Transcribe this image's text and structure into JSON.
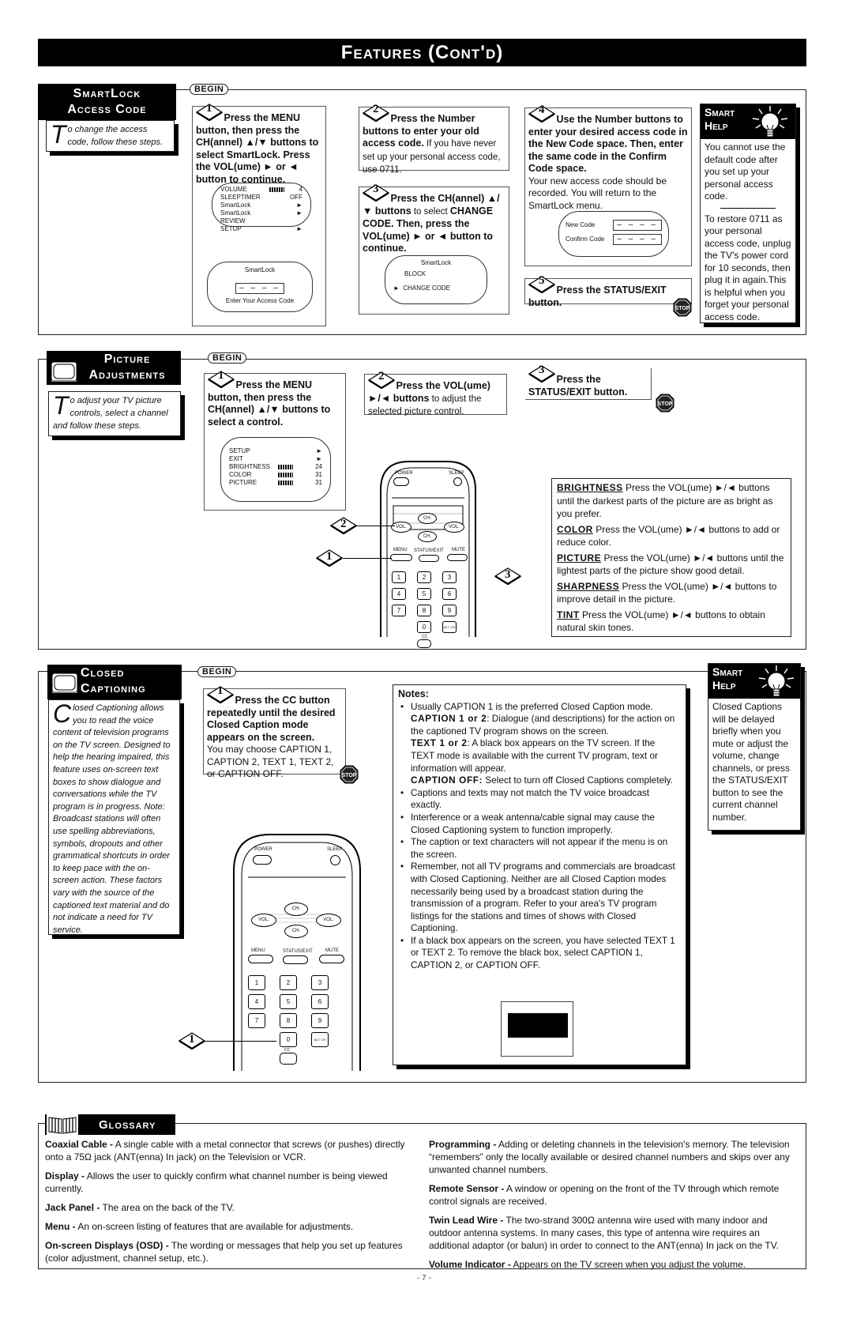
{
  "page": {
    "title": "Features (Cont'd)",
    "page_number": "- 7 -",
    "begin_label": "BEGIN"
  },
  "smartlock": {
    "title_line1": "SmartLock",
    "title_line2": "Access Code",
    "intro_dropcap": "T",
    "intro": "o change the access code, follow these steps.",
    "steps": [
      {
        "num": "1",
        "bold": "Press the MENU button, then press the CH(annel) ▲/▼ buttons to select SmartLock. Press the VOL(ume) ► or ◄ button to continue.",
        "plain": ""
      },
      {
        "num": "2",
        "bold": "Press the Number buttons to enter your old access code.",
        "plain": " If you have never set up your personal access code, use 0711."
      },
      {
        "num": "3",
        "bold": "Press the CH(annel) ▲/▼ buttons",
        "plain": " to select ",
        "bold2": "CHANGE CODE. Then, press the VOL(ume) ► or ◄ button to continue."
      },
      {
        "num": "4",
        "bold": "Use the Number buttons to enter your desired access code in the New Code space. Then, enter the same code in the Confirm Code space.",
        "plain": "Your new access code should be recorded. You will return to the SmartLock menu."
      },
      {
        "num": "5",
        "bold": "Press the STATUS/EXIT button.",
        "plain": ""
      }
    ],
    "osd_menu": [
      {
        "label": "VOLUME",
        "bar": true,
        "value": "4"
      },
      {
        "label": "SLEEPTIMER",
        "bar": false,
        "value": "OFF"
      },
      {
        "label": "SmartLock",
        "bar": false,
        "value": "►"
      },
      {
        "label": "SmartLock REVIEW",
        "bar": false,
        "value": "►"
      },
      {
        "label": "SETUP",
        "bar": false,
        "value": "►"
      }
    ],
    "osd_entry": {
      "title": "SmartLock",
      "code": "– – – –",
      "caption": "Enter Your Access Code"
    },
    "osd_smartlock": {
      "title": "SmartLock",
      "items": [
        "BLOCK",
        "CHANGE CODE"
      ],
      "selected_marker": "►"
    },
    "osd_newcode": {
      "new_label": "New Code",
      "confirm_label": "Confirm Code",
      "code": "– – – –"
    },
    "smart_help": {
      "title_line1": "Smart",
      "title_line2": "Help",
      "text1": "You cannot use the default code after you set up your personal access code.",
      "text2": "To restore 0711 as your personal access code, unplug the TV's power cord for 10 seconds, then plug it in again.This is helpful when you forget your personal access code."
    },
    "stop_label": "STOP"
  },
  "picture": {
    "title_line1": "Picture",
    "title_line2": "Adjustments",
    "intro_dropcap": "T",
    "intro": "o adjust your TV picture controls, select a channel and follow these steps.",
    "steps": [
      {
        "num": "1",
        "bold": "Press the MENU button, then press the CH(annel) ▲/▼ buttons to select a control.",
        "plain": ""
      },
      {
        "num": "2",
        "bold": "Press the VOL(ume) ►/◄ buttons",
        "plain": " to adjust the selected picture control."
      },
      {
        "num": "3",
        "bold": "Press the STATUS/EXIT button.",
        "plain": ""
      }
    ],
    "osd_menu": [
      {
        "label": "SETUP",
        "bar": false,
        "value": "►"
      },
      {
        "label": "EXIT",
        "bar": false,
        "value": "►"
      },
      {
        "label": "BRIGHTNESS",
        "bar": true,
        "value": "24"
      },
      {
        "label": "COLOR",
        "bar": true,
        "value": "31"
      },
      {
        "label": "PICTURE",
        "bar": true,
        "value": "31"
      }
    ],
    "controls": [
      {
        "term": "BRIGHTNESS",
        "desc": "Press the VOL(ume) ►/◄ buttons until the darkest parts of the picture are as bright as you prefer."
      },
      {
        "term": "COLOR",
        "desc": "Press the VOL(ume) ►/◄ buttons to add or reduce color."
      },
      {
        "term": "PICTURE",
        "desc": "Press the VOL(ume) ►/◄ buttons until the lightest parts of the picture show good detail."
      },
      {
        "term": "SHARPNESS",
        "desc": "Press the VOL(ume) ►/◄ buttons to improve detail in the picture."
      },
      {
        "term": "TINT",
        "desc": "Press the VOL(ume) ►/◄ buttons to obtain natural skin tones."
      }
    ]
  },
  "remote": {
    "power": "POWER",
    "sleep": "SLEEP",
    "ch": "CH.",
    "vol": "VOL.",
    "menu": "MENU",
    "status_exit": "STATUS/EXIT",
    "mute": "MUTE",
    "keys": [
      "1",
      "2",
      "3",
      "4",
      "5",
      "6",
      "7",
      "8",
      "9",
      "0"
    ],
    "alt_ch": "ALT. CH",
    "cc": "CC"
  },
  "closed_captioning": {
    "title_line1": "Closed",
    "title_line2": "Captioning",
    "intro_dropcap": "C",
    "intro": "losed Captioning allows you to read the voice content of television programs on the TV screen. Designed to help the hearing impaired, this feature uses on-screen text boxes to show dialogue and conversations while the TV program is in progress. Note: Broadcast stations will often use spelling abbreviations, symbols, dropouts and other grammatical shortcuts in order to keep pace with the on-screen action. These factors vary with the source of the captioned text material and do not indicate a need for TV service.",
    "step": {
      "num": "1",
      "bold": "Press the CC button repeatedly until the desired Closed Caption mode appears on the screen.",
      "plain": "You may choose CAPTION 1, CAPTION 2, TEXT 1, TEXT 2, or CAPTION OFF."
    },
    "notes_title": "Notes:",
    "notes": [
      {
        "text": "Usually CAPTION 1 is the preferred Closed Caption mode.",
        "subs": [
          {
            "term": "CAPTION 1 or 2",
            "desc": ": Dialogue (and descriptions) for the action on the captioned TV program shows on the screen."
          },
          {
            "term": "TEXT 1 or 2",
            "desc": ": A black box appears on the TV screen. If the TEXT mode is available with the current TV program, text or information will appear."
          },
          {
            "term": "CAPTION OFF:",
            "desc": " Select to turn off Closed Captions completely."
          }
        ]
      },
      {
        "text": "Captions and texts may not match the TV voice broadcast exactly.",
        "subs": []
      },
      {
        "text": "Interference or a weak antenna/cable signal may cause the Closed Captioning system to function improperly.",
        "subs": []
      },
      {
        "text": "The caption or text characters will not appear if the menu is on the screen.",
        "subs": []
      },
      {
        "text": "Remember, not all TV programs and commercials are broadcast with Closed Captioning. Neither are all Closed Caption modes necessarily being used by a broadcast station during the transmission of a program. Refer to your area's TV program listings for the stations and times of shows with Closed Captioning.",
        "subs": []
      },
      {
        "text": "If a black box appears on the screen, you have selected TEXT 1 or TEXT 2. To remove the black box, select CAPTION 1, CAPTION 2, or CAPTION OFF.",
        "subs": []
      }
    ],
    "smart_help": {
      "title_line1": "Smart",
      "title_line2": "Help",
      "text": "Closed Captions will be delayed briefly when you mute or adjust the volume, change channels, or press the STATUS/EXIT button to see the current channel number."
    }
  },
  "glossary": {
    "title": "Glossary",
    "left": [
      {
        "term": "Coaxial Cable -",
        "desc": " A single cable with a metal connector that screws (or pushes) directly onto a 75Ω jack (ANT(enna) In jack) on the Television or VCR."
      },
      {
        "term": "Display -",
        "desc": " Allows the user to quickly confirm what channel number is being viewed currently."
      },
      {
        "term": "Jack Panel -",
        "desc": " The area on the back of the TV."
      },
      {
        "term": "Menu -",
        "desc": " An on-screen listing of features that are available for adjustments."
      },
      {
        "term": "On-screen Displays (OSD) -",
        "desc": " The wording or messages that help you set up features (color adjustment, channel setup, etc.)."
      }
    ],
    "right": [
      {
        "term": "Programming -",
        "desc": " Adding or deleting channels in the television's memory. The television “remembers” only the locally available or desired channel numbers and skips over any unwanted channel numbers."
      },
      {
        "term": "Remote Sensor -",
        "desc": " A window or opening on the front of the TV through which remote control signals are received."
      },
      {
        "term": "Twin Lead Wire -",
        "desc": " The two-strand 300Ω antenna wire used with many indoor and outdoor antenna systems. In many cases, this type of antenna wire requires an additional adaptor (or balun) in order to connect to the ANT(enna) In jack on the TV."
      },
      {
        "term": "Volume Indicator -",
        "desc": " Appears on the TV screen when you adjust the volume."
      }
    ]
  }
}
